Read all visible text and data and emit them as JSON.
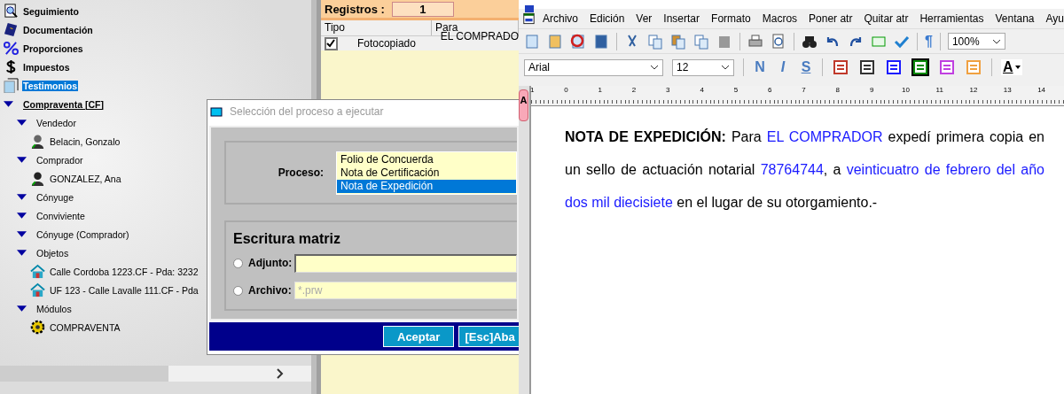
{
  "tree": {
    "items": [
      {
        "label": "Seguimiento",
        "kind": "tracking",
        "selected": false
      },
      {
        "label": "Documentación",
        "kind": "book",
        "selected": false
      },
      {
        "label": "Proporciones",
        "kind": "percent",
        "selected": false
      },
      {
        "label": "Impuestos",
        "kind": "tax",
        "selected": false
      },
      {
        "label": "Testimonios",
        "kind": "copies",
        "selected": true
      },
      {
        "label": "Compraventa [CF]",
        "kind": "group",
        "selected": false,
        "expanded": true,
        "children": [
          {
            "label": "Vendedor",
            "kind": "group",
            "selected": false,
            "expanded": true,
            "children": [
              {
                "label": "Belacin, Gonzalo",
                "kind": "man",
                "selected": false
              }
            ]
          },
          {
            "label": "Comprador",
            "kind": "group",
            "selected": false,
            "expanded": true,
            "children": [
              {
                "label": "GONZALEZ, Ana",
                "kind": "woman",
                "selected": false
              }
            ]
          },
          {
            "label": "Cónyuge",
            "kind": "group",
            "selected": false,
            "expanded": true
          },
          {
            "label": "Conviviente",
            "kind": "group",
            "selected": false,
            "expanded": true
          },
          {
            "label": "Cónyuge (Comprador)",
            "kind": "group",
            "selected": false,
            "expanded": true
          },
          {
            "label": "Objetos",
            "kind": "group",
            "selected": false,
            "expanded": true,
            "children": [
              {
                "label": "Calle Cordoba 1223.CF - Pda: 3232",
                "kind": "house",
                "selected": false
              },
              {
                "label": "UF 123 - Calle Lavalle 111.CF - Pda",
                "kind": "house",
                "selected": false
              }
            ]
          },
          {
            "label": "Módulos",
            "kind": "group",
            "selected": false,
            "expanded": true,
            "children": [
              {
                "label": "COMPRAVENTA",
                "kind": "module",
                "selected": false
              }
            ]
          }
        ]
      }
    ]
  },
  "records": {
    "label": "Registros :",
    "count": "1",
    "columns": [
      "Tipo",
      "Para"
    ],
    "rows": [
      {
        "checked": true,
        "tipo": "Fotocopiado",
        "para": "EL COMPRADO"
      }
    ]
  },
  "dialog": {
    "title": "Selección del proceso a ejecutar",
    "process_label": "Proceso:",
    "options": [
      {
        "label": "Folio de Concuerda",
        "selected": false
      },
      {
        "label": "Nota de Certificación",
        "selected": false
      },
      {
        "label": "Nota de Expedición",
        "selected": true
      }
    ],
    "section_title": "Escritura matriz",
    "sources": [
      {
        "label": "Adjunto:",
        "selected": false
      },
      {
        "label": "Archivo:",
        "selected": false,
        "placeholder": "*.prw"
      }
    ],
    "buttons": [
      {
        "label": "Aceptar",
        "kind": "primary"
      },
      {
        "label": "[Esc]Aba",
        "kind": "cancel"
      }
    ]
  },
  "editor": {
    "menu": [
      "Archivo",
      "Edición",
      "Ver",
      "Insertar",
      "Formato",
      "Macros",
      "Poner atr",
      "Quitar atr",
      "Herramientas",
      "Ventana",
      "Ayu"
    ],
    "pilcrow": "¶",
    "zoom": "100%",
    "font": "Arial",
    "size": "12",
    "format_buttons": [
      "N",
      "I",
      "S"
    ],
    "paragraph_styles": [
      {
        "color": "#c0392b",
        "selected": false
      },
      {
        "color": "#333333",
        "selected": false
      },
      {
        "color": "#1a1aff",
        "selected": false
      },
      {
        "color": "#0a8a0a",
        "selected": true
      },
      {
        "color": "#c040e0",
        "selected": false
      },
      {
        "color": "#f0a040",
        "selected": false
      }
    ],
    "font_color_letter": "A",
    "tab_letter": "A",
    "ruler": [
      "1",
      "0",
      "1",
      "2",
      "3",
      "4",
      "5",
      "6",
      "7",
      "8",
      "9",
      "10",
      "11",
      "12",
      "13",
      "14"
    ],
    "document": [
      {
        "text": "NOTA DE EXPEDICIÓN:",
        "kind": "heading"
      },
      {
        "text": " Para ",
        "kind": "text"
      },
      {
        "text": "EL COMPRADOR",
        "kind": "field"
      },
      {
        "text": " expedí primera copia en un sello de actuación notarial ",
        "kind": "text"
      },
      {
        "text": "78764744",
        "kind": "field"
      },
      {
        "text": ", a ",
        "kind": "text"
      },
      {
        "text": "veinticuatro de febrero del año dos mil diecisiete",
        "kind": "field"
      },
      {
        "text": " en el lugar de su otorgamiento.-",
        "kind": "text"
      }
    ]
  }
}
